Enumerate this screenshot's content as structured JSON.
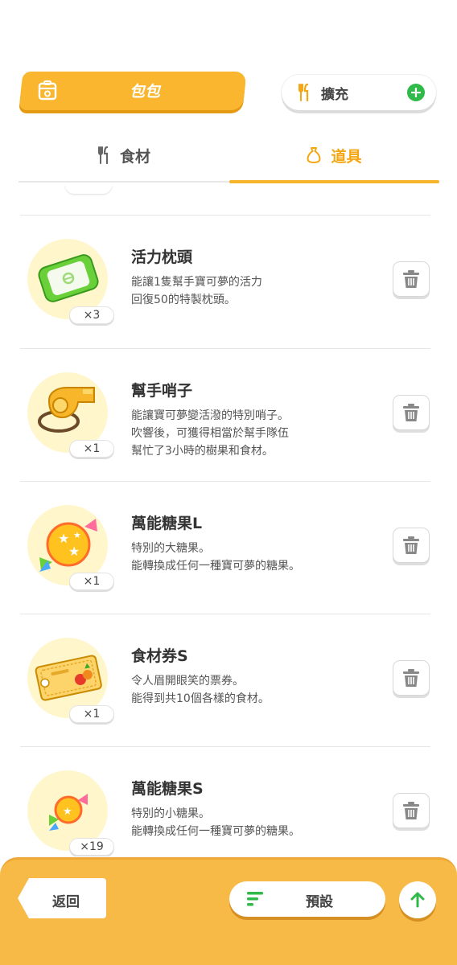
{
  "header": {
    "bag_label": "包包",
    "expand_label": "擴充",
    "expand_plus": "+"
  },
  "tabs": [
    {
      "label": "食材",
      "active": false
    },
    {
      "label": "道具",
      "active": true
    }
  ],
  "items": [
    {
      "name": "活力枕頭",
      "desc": "能讓1隻幫手寶可夢的活力\n回復50的特製枕頭。",
      "qty": "×3",
      "icon": "pillow-icon"
    },
    {
      "name": "幫手哨子",
      "desc": "能讓寶可夢變活潑的特別哨子。\n吹響後，可獲得相當於幫手隊伍\n幫忙了3小時的樹果和食材。",
      "qty": "×1",
      "icon": "whistle-icon"
    },
    {
      "name": "萬能糖果L",
      "desc": "特別的大糖果。\n能轉換成任何一種寶可夢的糖果。",
      "qty": "×1",
      "icon": "candy-large-icon"
    },
    {
      "name": "食材券S",
      "desc": "令人眉開眼笑的票券。\n能得到共10個各樣的食材。",
      "qty": "×1",
      "icon": "ingredient-ticket-icon"
    },
    {
      "name": "萬能糖果S",
      "desc": "特別的小糖果。\n能轉換成任何一種寶可夢的糖果。",
      "qty": "×19",
      "icon": "candy-small-icon"
    }
  ],
  "footer": {
    "back_label": "返回",
    "preset_label": "預設"
  },
  "colors": {
    "accent": "#f6b52b",
    "footer": "#f8ba47",
    "green": "#2fba4a"
  }
}
